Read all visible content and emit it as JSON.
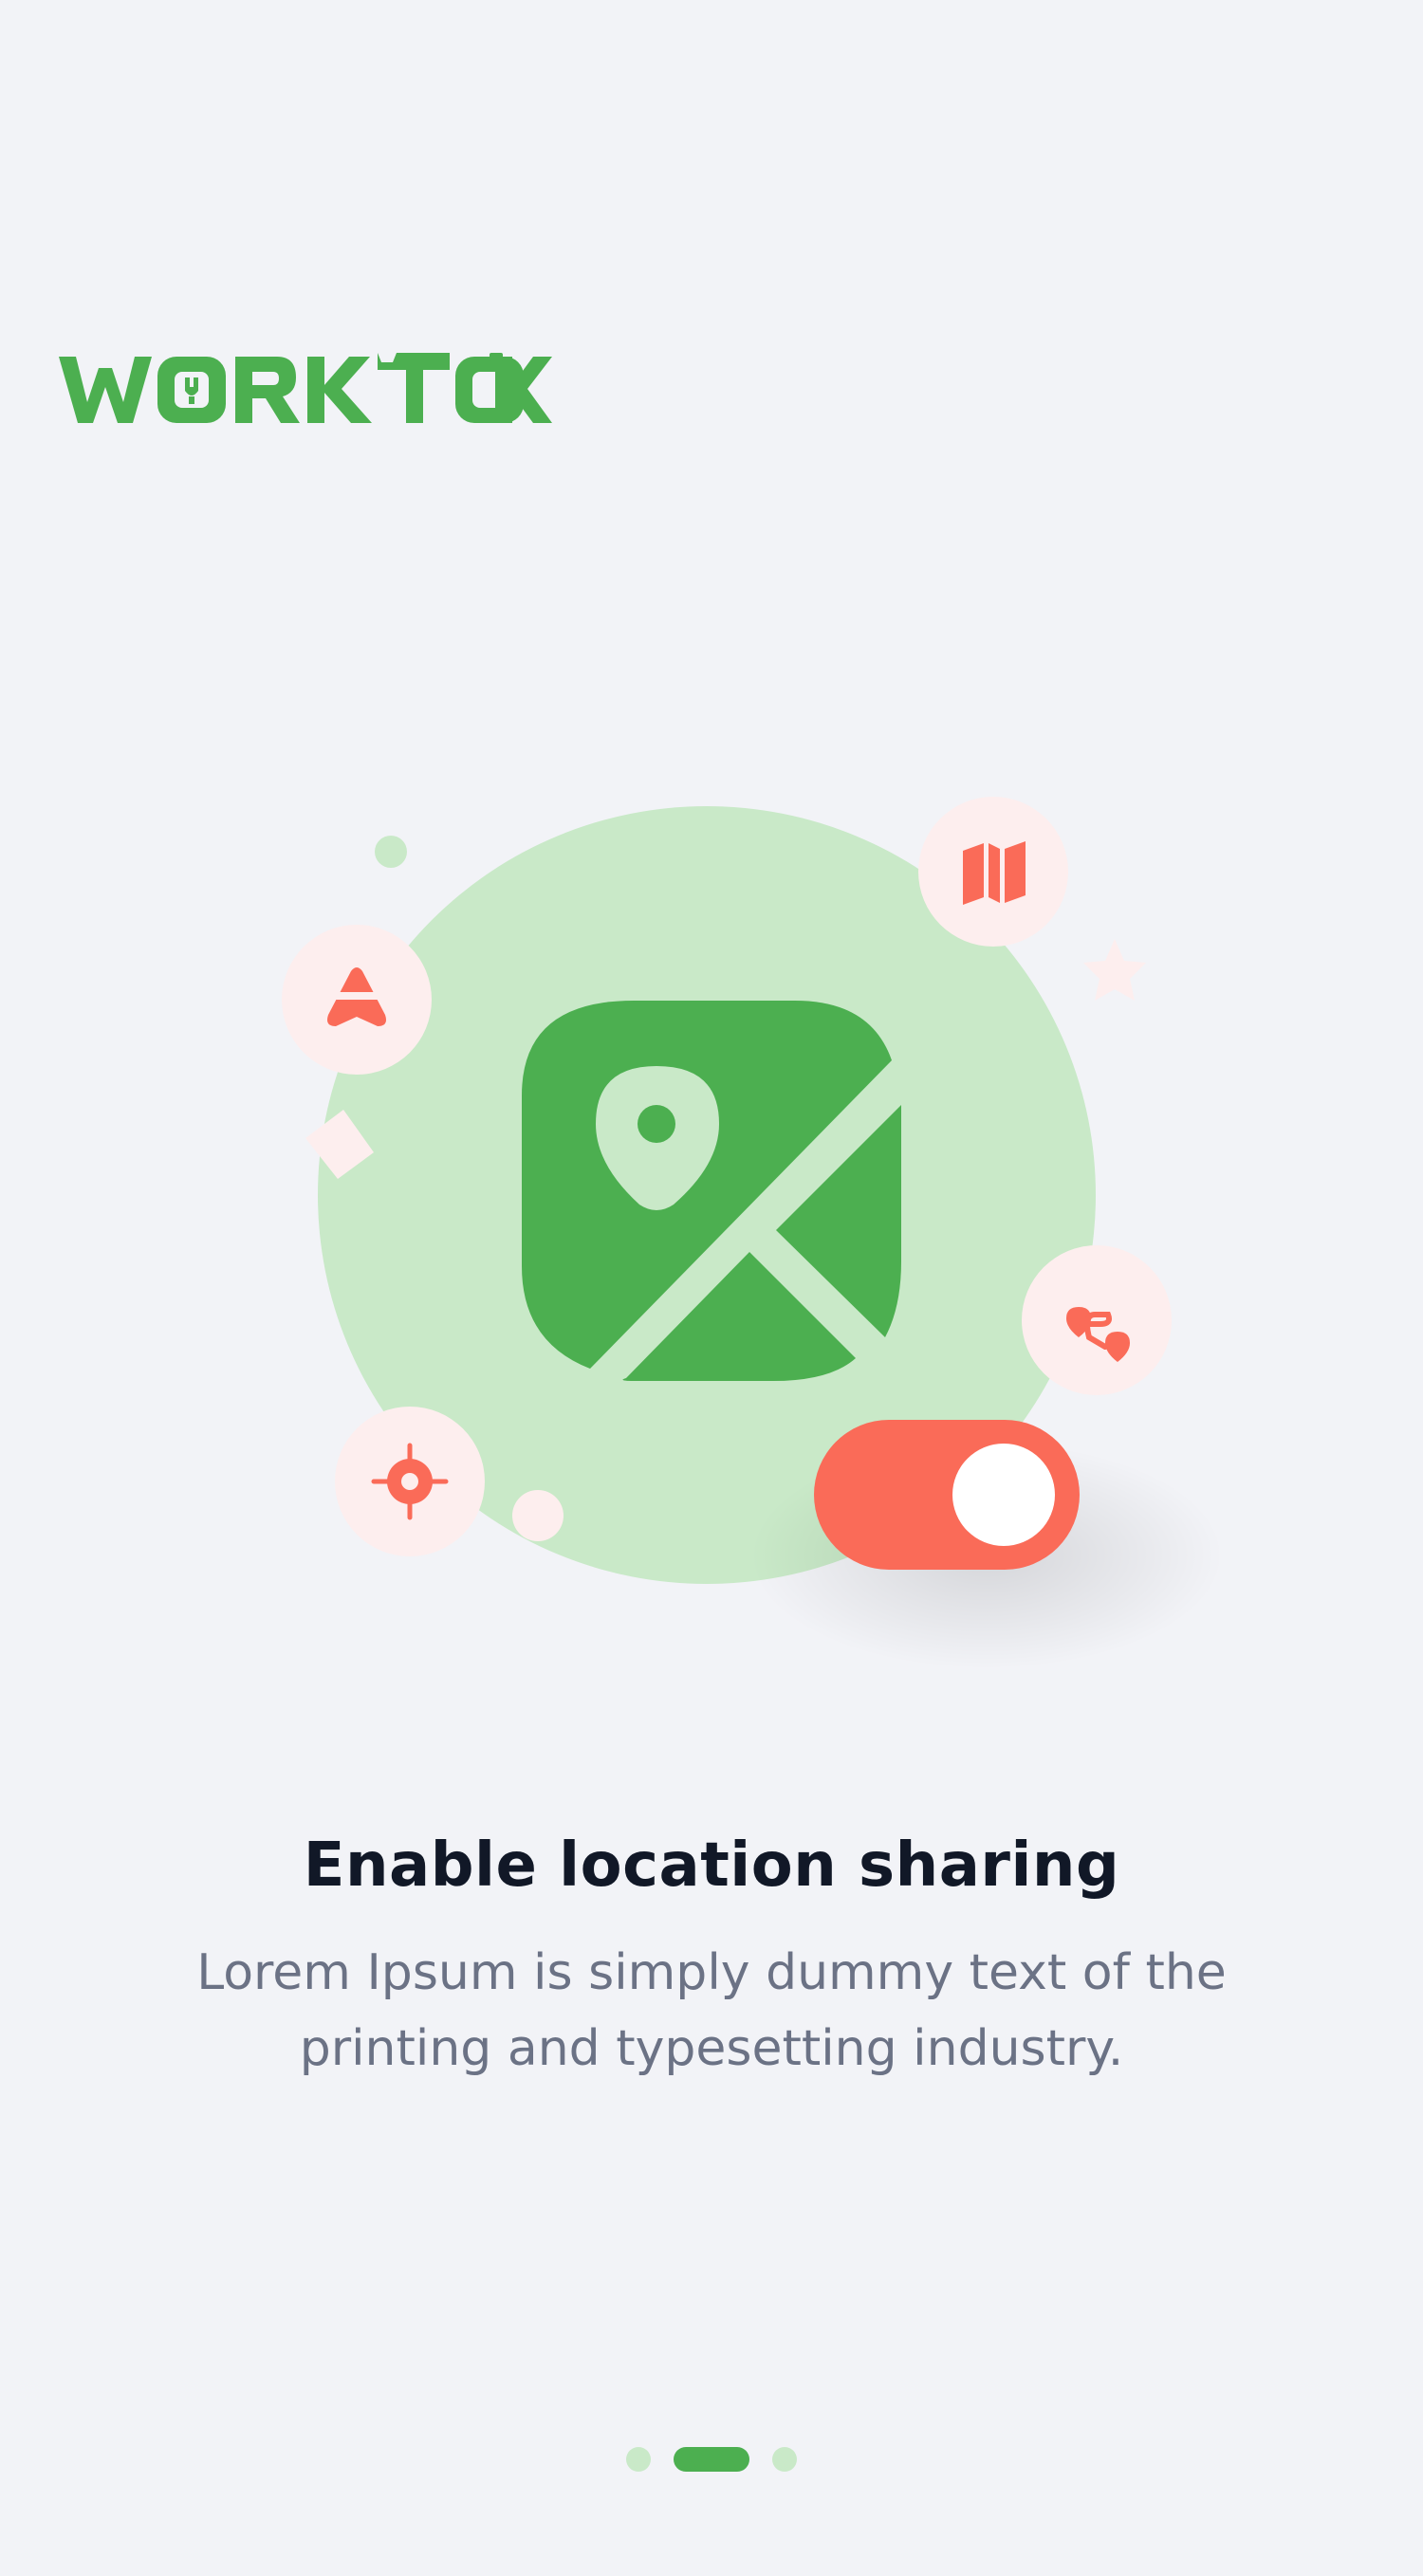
{
  "brand": {
    "logo_text": "WORKTOK",
    "logo_color": "#4CAF50"
  },
  "illustration": {
    "main_icon": "map-pin-image-icon",
    "toggle_state": "on",
    "toggle_color": "#FA6B58",
    "floating_icons": [
      "navigation-icon",
      "map-icon",
      "route-icon",
      "target-icon"
    ],
    "circle_color": "#C9E9C8",
    "badge_color": "#FDEEEE"
  },
  "content": {
    "title": "Enable location sharing",
    "subtitle": "Lorem Ipsum is simply dummy text of the printing and typesetting industry."
  },
  "pager": {
    "total": 3,
    "active_index": 1
  }
}
